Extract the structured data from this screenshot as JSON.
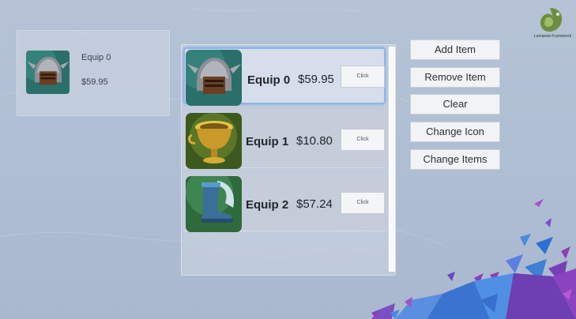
{
  "logo": {
    "text": "Lamanda Framework",
    "color": "#5c7a3a"
  },
  "preview": {
    "name": "Equip 0",
    "price": "$59.95",
    "icon": "helmet-icon"
  },
  "items": [
    {
      "name": "Equip 0",
      "price": "$59.95",
      "button": "Click",
      "icon": "helmet-icon",
      "selected": true
    },
    {
      "name": "Equip 1",
      "price": "$10.80",
      "button": "Click",
      "icon": "golden-chalice-icon",
      "selected": false
    },
    {
      "name": "Equip 2",
      "price": "$57.24",
      "button": "Click",
      "icon": "winged-boot-icon",
      "selected": false
    }
  ],
  "actions": {
    "add_item": "Add Item",
    "remove_item": "Remove Item",
    "clear": "Clear",
    "change_icon": "Change Icon",
    "change_items": "Change Items"
  },
  "colors": {
    "accent": "#8fb5e6",
    "background": "#b6c3d6",
    "shard_purple": "#8d3fb8",
    "shard_blue": "#3f7fd6"
  }
}
